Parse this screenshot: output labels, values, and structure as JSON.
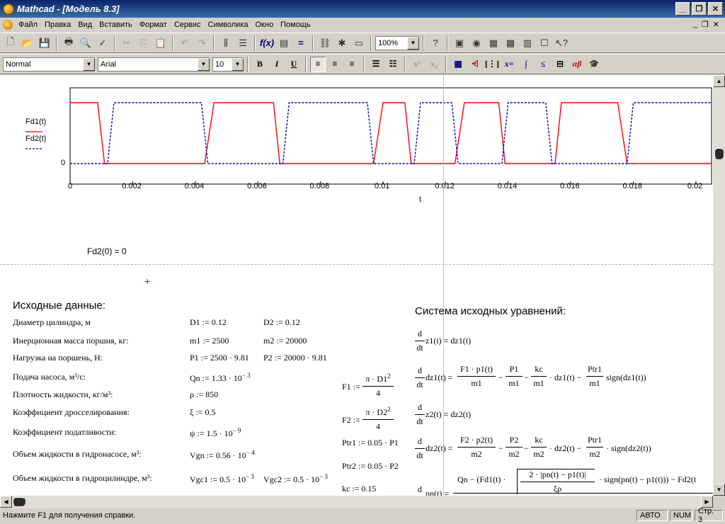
{
  "window": {
    "title": "Mathcad - [Модель 8.3]"
  },
  "menu": [
    "Файл",
    "Правка",
    "Вид",
    "Вставить",
    "Формат",
    "Сервис",
    "Символика",
    "Окно",
    "Помощь"
  ],
  "toolbar": {
    "zoom": "100%"
  },
  "format_bar": {
    "style": "Normal",
    "font": "Arial",
    "size": "10",
    "bold": "B",
    "italic": "I",
    "underline": "U"
  },
  "plot": {
    "legend": [
      "Fd1(t)",
      "Fd2(t)"
    ],
    "y_tick": "0",
    "x_ticks": [
      "0",
      "0.002",
      "0.004",
      "0.006",
      "0.008",
      "0.01",
      "0.012",
      "0.014",
      "0.016",
      "0.018",
      "0.02"
    ],
    "xlabel": "t",
    "fd1_color": "#ff0000",
    "fd2_color": "#0000cc"
  },
  "chart_data": {
    "type": "line",
    "x_range": [
      0,
      0.0205
    ],
    "series": [
      {
        "name": "Fd1(t)",
        "style": "solid",
        "points": [
          [
            0,
            1
          ],
          [
            0.00088,
            1
          ],
          [
            0.0011,
            0
          ],
          [
            0.0043,
            0
          ],
          [
            0.0046,
            1
          ],
          [
            0.0065,
            1
          ],
          [
            0.0067,
            0
          ],
          [
            0.0097,
            0
          ],
          [
            0.01,
            1
          ],
          [
            0.0107,
            1
          ],
          [
            0.0109,
            0
          ],
          [
            0.0123,
            0
          ],
          [
            0.0126,
            1
          ],
          [
            0.0137,
            1
          ],
          [
            0.0139,
            0
          ],
          [
            0.0155,
            0
          ],
          [
            0.0157,
            1
          ],
          [
            0.0175,
            1
          ],
          [
            0.0178,
            0
          ],
          [
            0.0205,
            0
          ]
        ]
      },
      {
        "name": "Fd2(t)",
        "style": "dashed",
        "points": [
          [
            0,
            0
          ],
          [
            0.0012,
            0
          ],
          [
            0.0014,
            1
          ],
          [
            0.0042,
            1
          ],
          [
            0.0044,
            0
          ],
          [
            0.0068,
            0
          ],
          [
            0.007,
            1
          ],
          [
            0.0095,
            1
          ],
          [
            0.0097,
            0
          ],
          [
            0.011,
            0
          ],
          [
            0.0112,
            1
          ],
          [
            0.0122,
            1
          ],
          [
            0.0124,
            0
          ],
          [
            0.0138,
            0
          ],
          [
            0.014,
            1
          ],
          [
            0.0152,
            1
          ],
          [
            0.0154,
            0
          ],
          [
            0.0178,
            0
          ],
          [
            0.018,
            1
          ],
          [
            0.0205,
            1
          ]
        ]
      }
    ]
  },
  "eval": "Fd2(0) = 0",
  "left": {
    "heading": "Исходные данные:",
    "rows": [
      {
        "label": "Диаметр цилиндра, м",
        "a": "D1 := 0.12",
        "b": "D2 := 0.12"
      },
      {
        "label": "Инерционная масса поршня, кг:",
        "a": "m1 := 2500",
        "b": "m2 := 20000"
      },
      {
        "label": "Нагрузка на поршень, Н:",
        "a": "P1 := 2500 · 9.81",
        "b": "P2 := 20000 · 9.81"
      },
      {
        "label": "Подача насоса, м³/с:",
        "a": "Qn := 1.33 · 10",
        "a_exp": "− 3"
      },
      {
        "label": "Плотность жидкости, кг/м³:",
        "a": "ρ := 850"
      },
      {
        "label": "Коэффициент дросселирования:",
        "a": "ξ := 0.5"
      },
      {
        "label": "Коэффициент податливости:",
        "a": "ψ := 1.5 · 10",
        "a_exp": "− 9"
      },
      {
        "label": "Объем жидкости в гидронасосе, м³:",
        "a": "Vgn := 0.56 · 10",
        "a_exp": "− 4"
      },
      {
        "label": "Объем жидкости в гидроцилиндре, м³:",
        "a": "Vgc1 := 0.5 · 10",
        "a_exp": "− 3",
        "b": "Vgc2 := 0.5 · 10",
        "b_exp": "− 3"
      }
    ]
  },
  "mid": {
    "f1_lhs": "F1 :=",
    "f1_num": "π · D1",
    "f1_exp": "2",
    "f1_den": "4",
    "f2_lhs": "F2 :=",
    "f2_num": "π · D2",
    "f2_exp": "2",
    "f2_den": "4",
    "ptr1": "Ptr1 := 0.05 · P1",
    "ptr2": "Ptr2 := 0.05 · P2",
    "kc": "kc := 0.15"
  },
  "right": {
    "heading": "Система исходных уравнений:",
    "d": "d",
    "dt": "dt",
    "eq1": "z1(t) = dz1(t)",
    "eq2_lhs": "dz1(t) =",
    "eq2_t1n": "F1 · p1(t)",
    "eq2_t1d": "m1",
    "eq2_t2n": "P1",
    "eq2_t2d": "m1",
    "eq2_t3n": "kc",
    "eq2_t3d": "m1",
    "eq2_mid": "· dz1(t) −",
    "eq2_t4n": "Ptr1",
    "eq2_t4d": "m1",
    "eq2_end": "sign(dz1(t))",
    "eq3": "z2(t) = dz2(t)",
    "eq4_lhs": "dz2(t) =",
    "eq4_t1n": "F2 · p2(t)",
    "eq4_t1d": "m2",
    "eq4_t2n": "P2",
    "eq4_t2d": "m2",
    "eq4_t3n": "kc",
    "eq4_t3d": "m2",
    "eq4_mid": "· dz2(t) −",
    "eq4_t4n": "Ptr1",
    "eq4_t4d": "m2",
    "eq4_end": "· sign(dz2(t))",
    "eq5_lhs": "pn(t) =",
    "eq5_num": "Qn − (Fd1(t) ·",
    "eq5_root": "2 · |pn(t) − p1(t)|",
    "eq5_rootden": "ξρ",
    "eq5_tail": "· sign(pn(t) − p1(t))) − Fd2(t"
  },
  "status": {
    "help": "Нажмите F1 для получения справки.",
    "mode": "АВТО",
    "num": "NUM",
    "page": "Стр. 3"
  }
}
